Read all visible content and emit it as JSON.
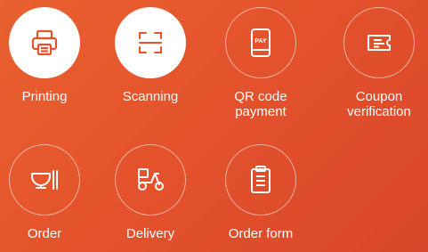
{
  "accent_color": "#e4532c",
  "tiles": [
    {
      "label_lines": [
        "Printing"
      ],
      "icon": "printer-icon",
      "style": "filled"
    },
    {
      "label_lines": [
        "Scanning"
      ],
      "icon": "scan-frame-icon",
      "style": "filled"
    },
    {
      "label_lines": [
        "QR code",
        "payment"
      ],
      "icon": "pay-phone-icon",
      "icon_text": "PAY",
      "style": "outline"
    },
    {
      "label_lines": [
        "Coupon",
        "verification"
      ],
      "icon": "ticket-icon",
      "style": "outline"
    },
    {
      "label_lines": [
        "Order"
      ],
      "icon": "bowl-icon",
      "style": "outline"
    },
    {
      "label_lines": [
        "Delivery"
      ],
      "icon": "scooter-icon",
      "style": "outline"
    },
    {
      "label_lines": [
        "Order form"
      ],
      "icon": "clipboard-icon",
      "style": "outline"
    }
  ]
}
